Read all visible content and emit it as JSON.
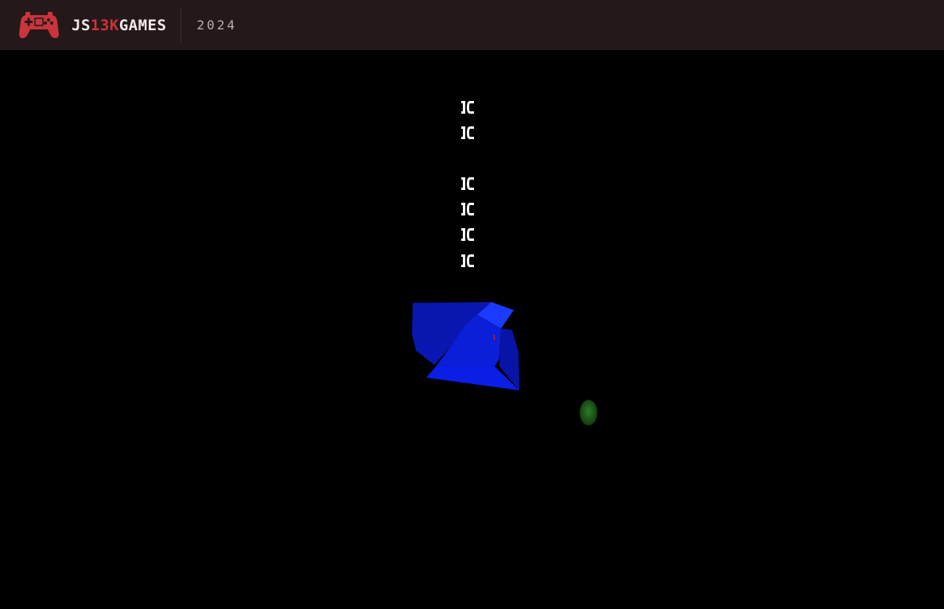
{
  "header": {
    "brand_prefix": "JS",
    "brand_accent": "13K",
    "brand_suffix": "GAMES",
    "year": "2024",
    "brand_color": "#c9343d",
    "logo_icon": "gamepad-icon"
  },
  "game": {
    "status_glyph_count": 6,
    "glyph_icon": "bracket-glyph-icon",
    "objects": [
      {
        "name": "blue-polyhedron",
        "color": "#0a1ee6"
      },
      {
        "name": "green-orb",
        "color": "#1f5c1a"
      }
    ]
  }
}
